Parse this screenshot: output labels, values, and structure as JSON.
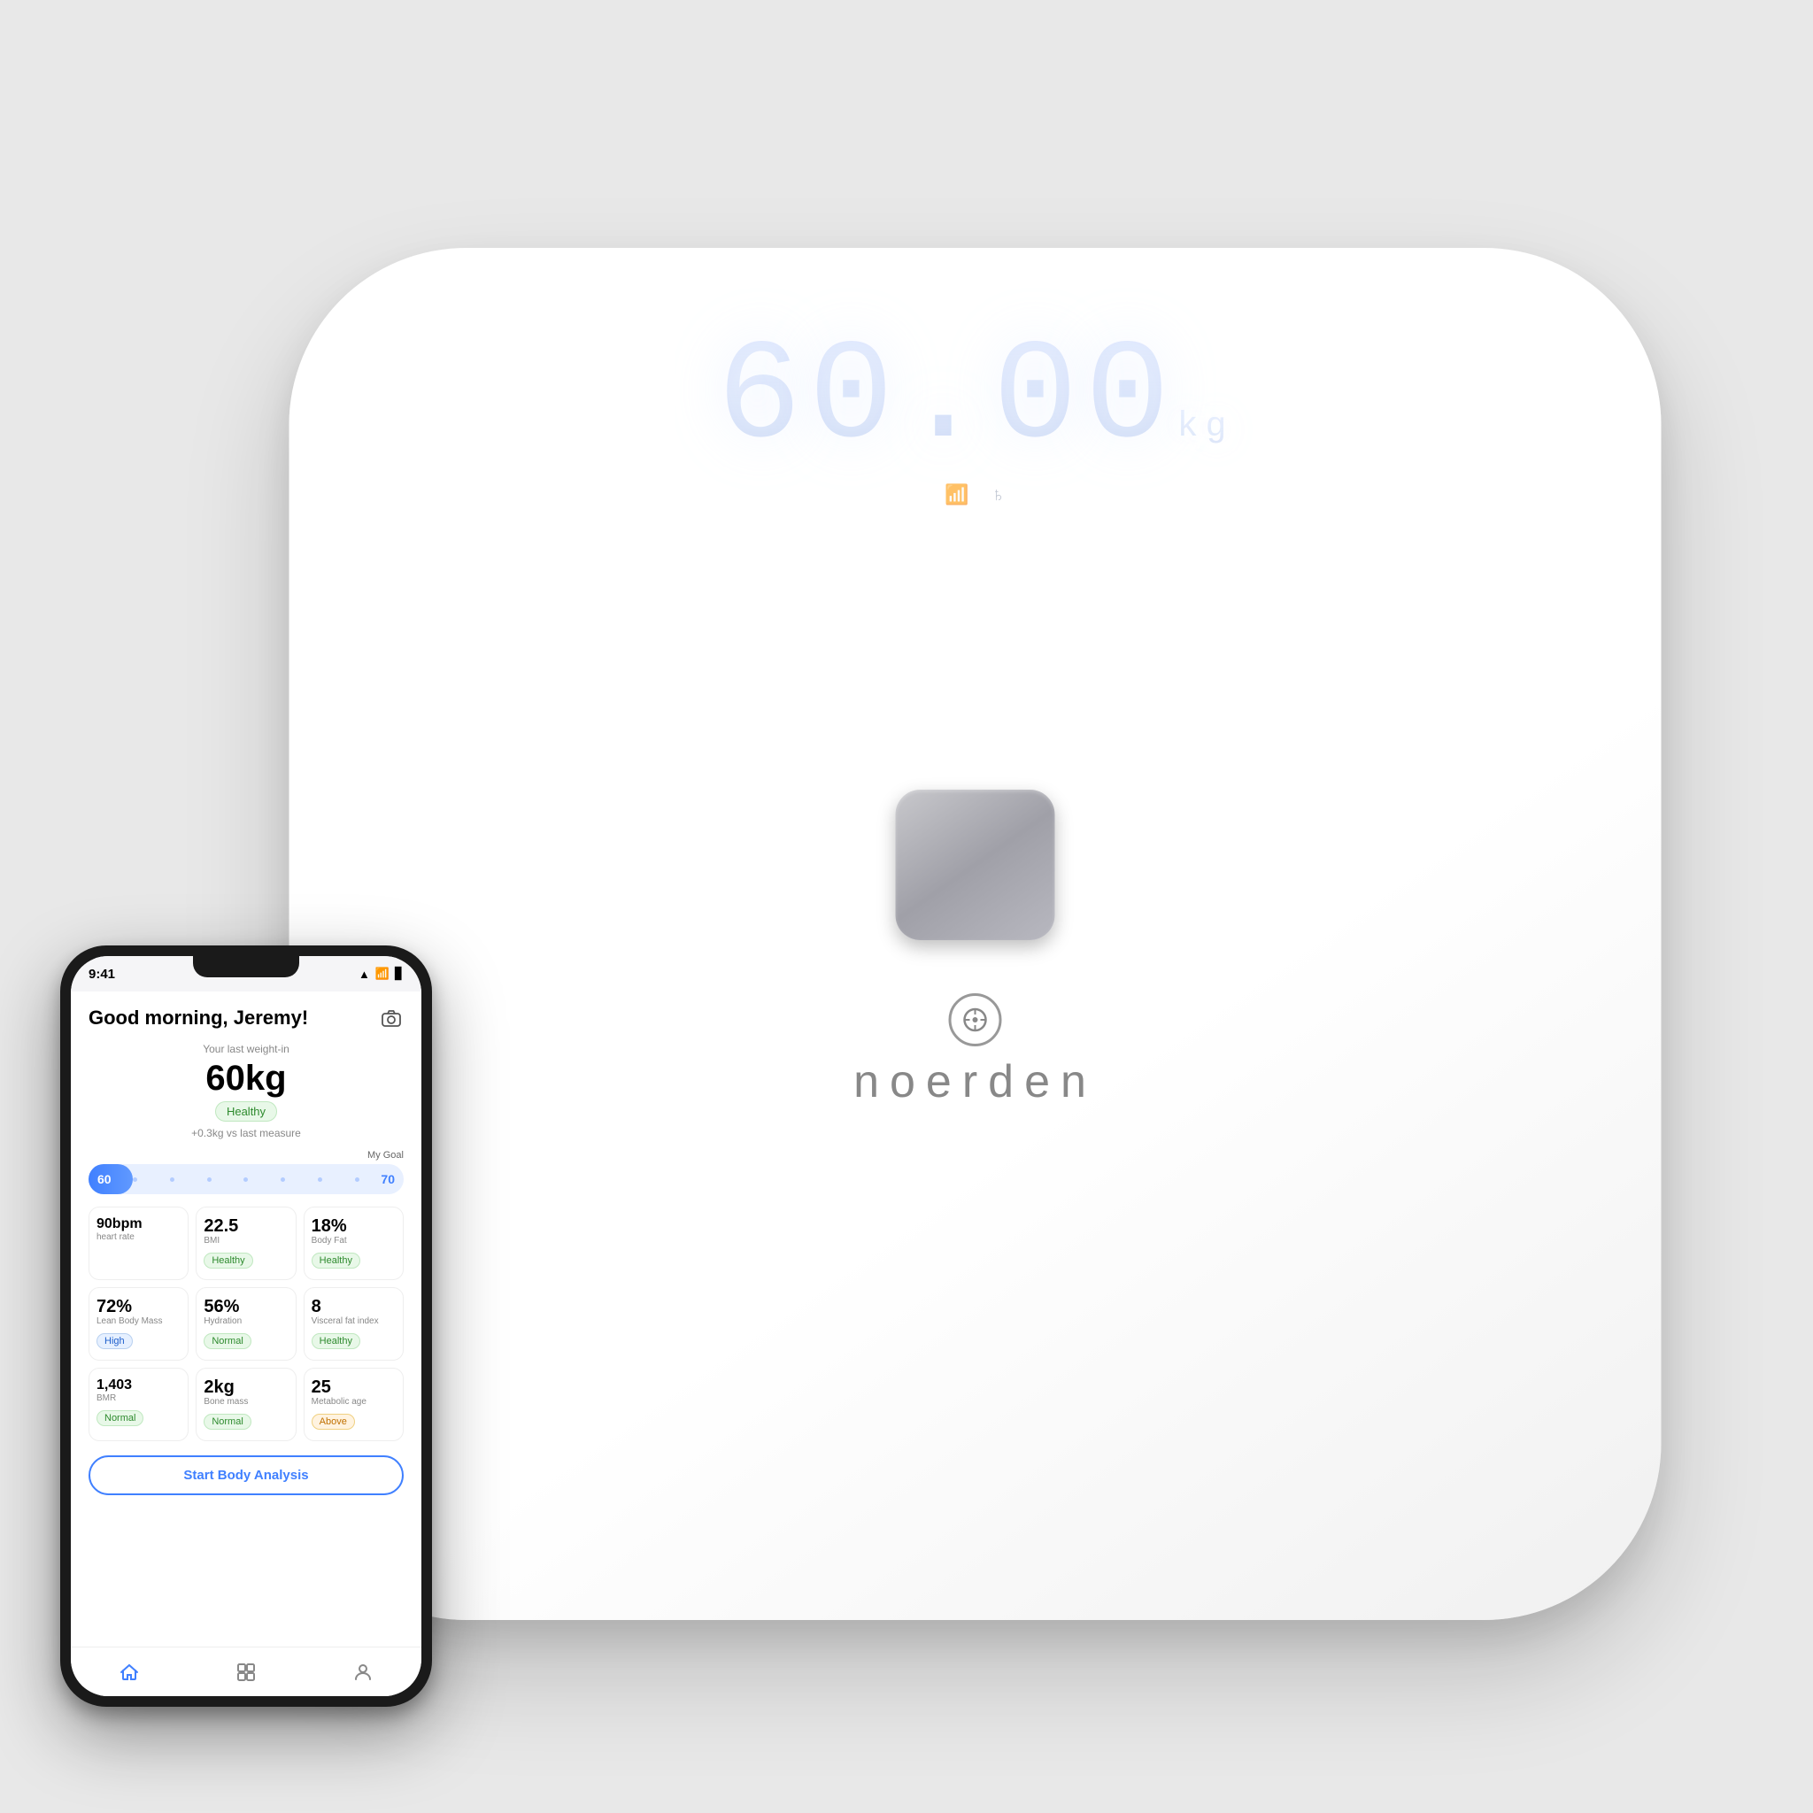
{
  "scale": {
    "weight": "60.00",
    "unit": "kg",
    "brand": "noerDen"
  },
  "phone": {
    "status_bar": {
      "time": "9:41",
      "signal": "▲▼",
      "wifi": "WiFi",
      "battery": "🔋"
    },
    "greeting": "Good morning, Jeremy!",
    "last_weigh_label": "Your last weight-in",
    "weight_value": "60kg",
    "weight_status": "Healthy",
    "weight_delta": "+0.3kg vs last measure",
    "goal_label": "My Goal",
    "goal_start": "60",
    "goal_end": "70",
    "metrics": [
      {
        "value": "90bpm",
        "label": "heart rate",
        "badge": null,
        "badge_type": null
      },
      {
        "value": "22.5",
        "label": "BMI",
        "badge": "Healthy",
        "badge_type": "green"
      },
      {
        "value": "18%",
        "label": "Body Fat",
        "badge": "Healthy",
        "badge_type": "green"
      },
      {
        "value": "72%",
        "label": "Lean Body Mass",
        "badge": "High",
        "badge_type": "blue"
      },
      {
        "value": "56%",
        "label": "Hydration",
        "badge": "Normal",
        "badge_type": "green"
      },
      {
        "value": "8",
        "label": "Visceral fat index",
        "badge": "Healthy",
        "badge_type": "green"
      },
      {
        "value": "1,403",
        "label": "BMR",
        "badge": "Normal",
        "badge_type": "green"
      },
      {
        "value": "2kg",
        "label": "Bone mass",
        "badge": "Normal",
        "badge_type": "green"
      },
      {
        "value": "25",
        "label": "Metabolic age",
        "badge": "Above",
        "badge_type": "orange"
      }
    ],
    "start_button_label": "Start Body Analysis",
    "nav_items": [
      "home",
      "grid",
      "person"
    ]
  }
}
